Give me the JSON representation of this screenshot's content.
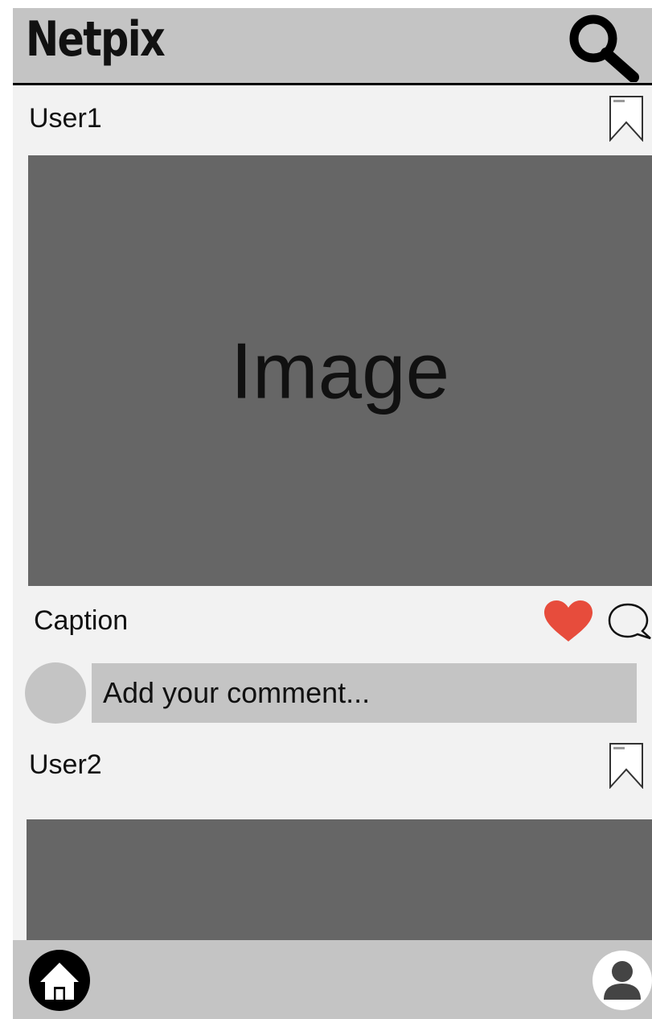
{
  "header": {
    "title": "Netpix",
    "search_icon": "search-icon"
  },
  "posts": [
    {
      "user": "User1",
      "image_label": "Image",
      "caption": "Caption",
      "liked": true,
      "like_color": "#e74c3c",
      "bookmark_icon": "bookmark-icon"
    },
    {
      "user": "User2",
      "bookmark_icon": "bookmark-icon"
    }
  ],
  "comment": {
    "placeholder": "Add your comment..."
  },
  "bottom_nav": {
    "home_icon": "home-icon",
    "profile_icon": "profile-icon"
  },
  "colors": {
    "bar": "#c4c4c4",
    "image_bg": "#666666",
    "page_bg": "#f2f2f2",
    "like": "#e74c3c"
  }
}
